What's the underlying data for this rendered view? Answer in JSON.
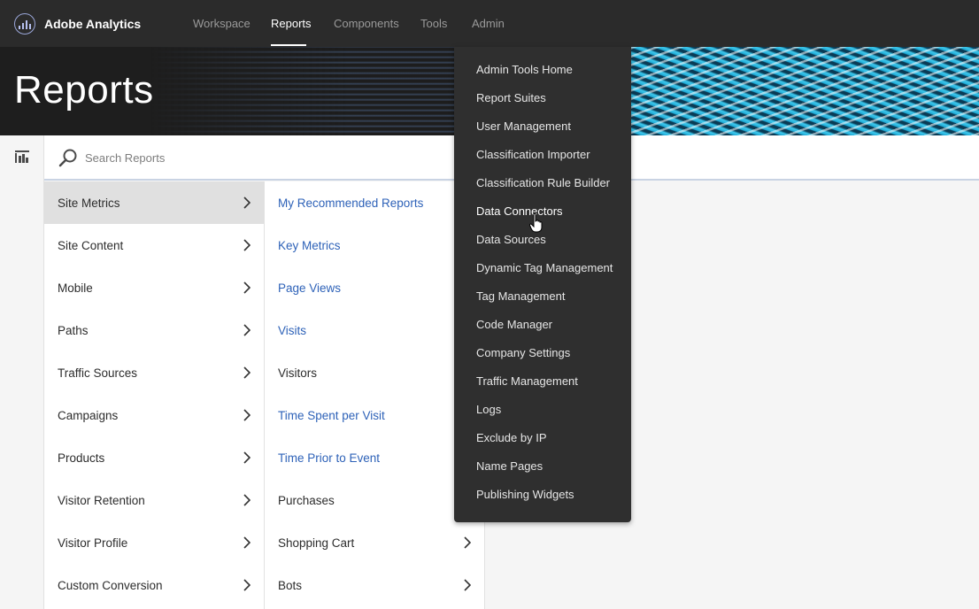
{
  "app": {
    "name": "Adobe Analytics"
  },
  "nav": {
    "items": [
      {
        "label": "Workspace"
      },
      {
        "label": "Reports"
      },
      {
        "label": "Components"
      },
      {
        "label": "Tools"
      },
      {
        "label": "Admin"
      }
    ],
    "active": "Reports"
  },
  "page": {
    "title": "Reports"
  },
  "search": {
    "placeholder": "Search Reports",
    "value": ""
  },
  "categories": [
    {
      "label": "Site Metrics",
      "selected": true
    },
    {
      "label": "Site Content"
    },
    {
      "label": "Mobile"
    },
    {
      "label": "Paths"
    },
    {
      "label": "Traffic Sources"
    },
    {
      "label": "Campaigns"
    },
    {
      "label": "Products"
    },
    {
      "label": "Visitor Retention"
    },
    {
      "label": "Visitor Profile"
    },
    {
      "label": "Custom Conversion"
    }
  ],
  "reports": [
    {
      "label": "My Recommended Reports",
      "link": true
    },
    {
      "label": "Key Metrics",
      "link": true
    },
    {
      "label": "Page Views",
      "link": true
    },
    {
      "label": "Visits",
      "link": true
    },
    {
      "label": "Visitors",
      "submenu": true
    },
    {
      "label": "Time Spent per Visit",
      "link": true
    },
    {
      "label": "Time Prior to Event",
      "link": true
    },
    {
      "label": "Purchases",
      "submenu": true
    },
    {
      "label": "Shopping Cart",
      "submenu": true
    },
    {
      "label": "Bots",
      "submenu": true
    }
  ],
  "admin_menu": {
    "items": [
      {
        "label": "Admin Tools Home"
      },
      {
        "label": "Report Suites"
      },
      {
        "label": "User Management"
      },
      {
        "label": "Classification Importer"
      },
      {
        "label": "Classification Rule Builder"
      },
      {
        "label": "Data Connectors",
        "hovered": true
      },
      {
        "label": "Data Sources"
      },
      {
        "label": "Dynamic Tag Management"
      },
      {
        "label": "Tag Management"
      },
      {
        "label": "Code Manager"
      },
      {
        "label": "Company Settings"
      },
      {
        "label": "Traffic Management"
      },
      {
        "label": "Logs"
      },
      {
        "label": "Exclude by IP"
      },
      {
        "label": "Name Pages"
      },
      {
        "label": "Publishing Widgets"
      }
    ]
  },
  "colors": {
    "nav_bg": "#2b2b2b",
    "link": "#2e62b8",
    "selected_row": "#e0e0e0",
    "dropdown_bg": "#2f2f2f"
  }
}
